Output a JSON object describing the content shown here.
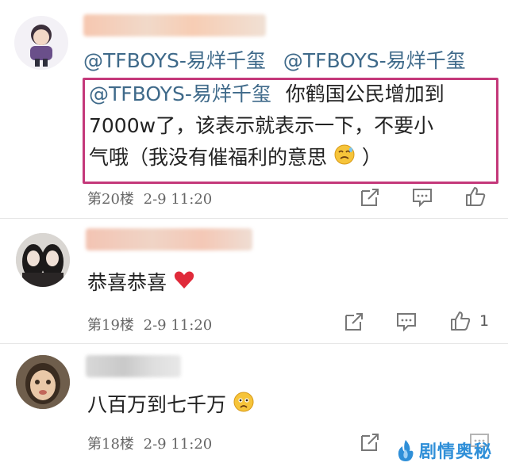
{
  "comments": [
    {
      "mentions": [
        "@TFBOYS-易烊千玺",
        "@TFBOYS-易烊千玺",
        "@TFBOYS-易烊千玺"
      ],
      "text_line1": "你鹤国公民增加到",
      "text_line2": "7000w了，该表示就表示一下，不要小",
      "text_line3": "气哦（我没有催福利的意思",
      "text_line3_end": "）",
      "floor": "第20楼",
      "time": "2-9  11:20",
      "likes": ""
    },
    {
      "text": "恭喜恭喜",
      "floor": "第19楼",
      "time": "2-9  11:20",
      "likes": "1"
    },
    {
      "text": "八百万到七千万",
      "floor": "第18楼",
      "time": "2-9  11:20",
      "likes": ""
    }
  ],
  "icons": [
    "share-icon",
    "comment-icon",
    "thumb-up-icon",
    "heart-emoji",
    "sweat-emoji",
    "sad-emoji",
    "flame-logo-icon"
  ],
  "colors": {
    "mention": "#3f6a8a",
    "highlight": "#c4387a",
    "heart": "#e02a3a",
    "watermark": "#2f8fd8"
  },
  "watermark": {
    "text": "剧情奥秘"
  }
}
